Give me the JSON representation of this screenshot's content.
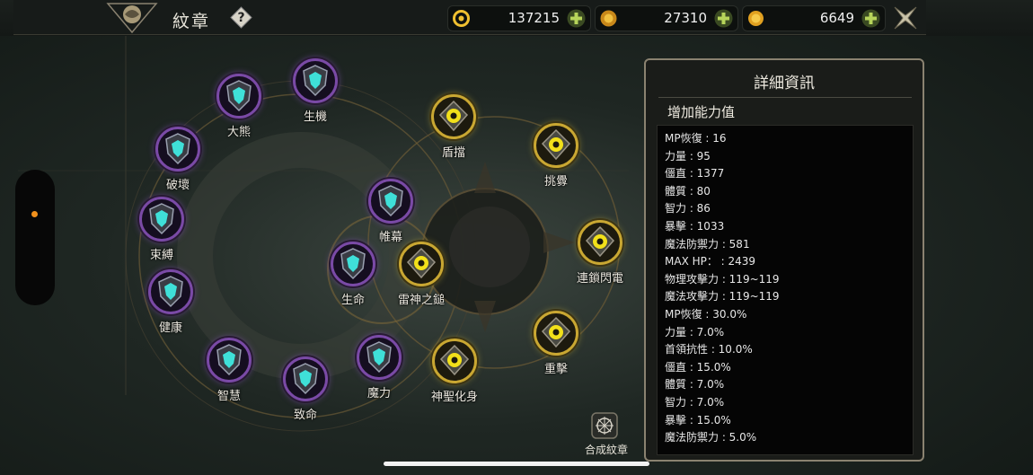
{
  "header": {
    "title": "紋章",
    "help_icon": "question-mark-icon"
  },
  "currencies": [
    {
      "icon": "swirl-coin-icon",
      "value": "137215",
      "color": "#f0c030"
    },
    {
      "icon": "gold-medal-icon",
      "value": "27310",
      "color": "#e0a020"
    },
    {
      "icon": "gold-coin-icon",
      "value": "6649",
      "color": "#f0b020"
    }
  ],
  "colors": {
    "purple_node": "#7a4aa6",
    "gold_node": "#c9a732",
    "cyan_emblem": "#3fe0d8",
    "yellow_emblem": "#f2e01a",
    "side_dot": "#f0901c"
  },
  "emblems": [
    {
      "label": "生機",
      "type": "purple"
    },
    {
      "label": "大熊",
      "type": "purple"
    },
    {
      "label": "破壞",
      "type": "purple"
    },
    {
      "label": "束縛",
      "type": "purple"
    },
    {
      "label": "健康",
      "type": "purple"
    },
    {
      "label": "智慧",
      "type": "purple"
    },
    {
      "label": "致命",
      "type": "purple"
    },
    {
      "label": "魔力",
      "type": "purple"
    },
    {
      "label": "帷幕",
      "type": "purple"
    },
    {
      "label": "生命",
      "type": "purple"
    },
    {
      "label": "雷神之鎚",
      "type": "gold"
    },
    {
      "label": "盾擋",
      "type": "gold"
    },
    {
      "label": "挑釁",
      "type": "gold"
    },
    {
      "label": "連鎖閃電",
      "type": "gold"
    },
    {
      "label": "重擊",
      "type": "gold"
    },
    {
      "label": "神聖化身",
      "type": "gold"
    }
  ],
  "combine": {
    "label": "合成紋章"
  },
  "panel": {
    "title": "詳細資訊",
    "subtitle": "增加能力值",
    "stats": [
      "MP恢復 : 16",
      "力量 : 95",
      "僵直 : 1377",
      "體質 : 80",
      "智力 : 86",
      "暴擊 : 1033",
      "魔法防禦力 : 581",
      "MAX HP：  : 2439",
      "物理攻擊力 : 119~119",
      "魔法攻擊力 : 119~119",
      "MP恢復 : 30.0%",
      "力量 : 7.0%",
      "首領抗性 : 10.0%",
      "僵直 : 15.0%",
      "體質 : 7.0%",
      "智力 : 7.0%",
      "暴擊 : 15.0%",
      "魔法防禦力 : 5.0%"
    ]
  }
}
